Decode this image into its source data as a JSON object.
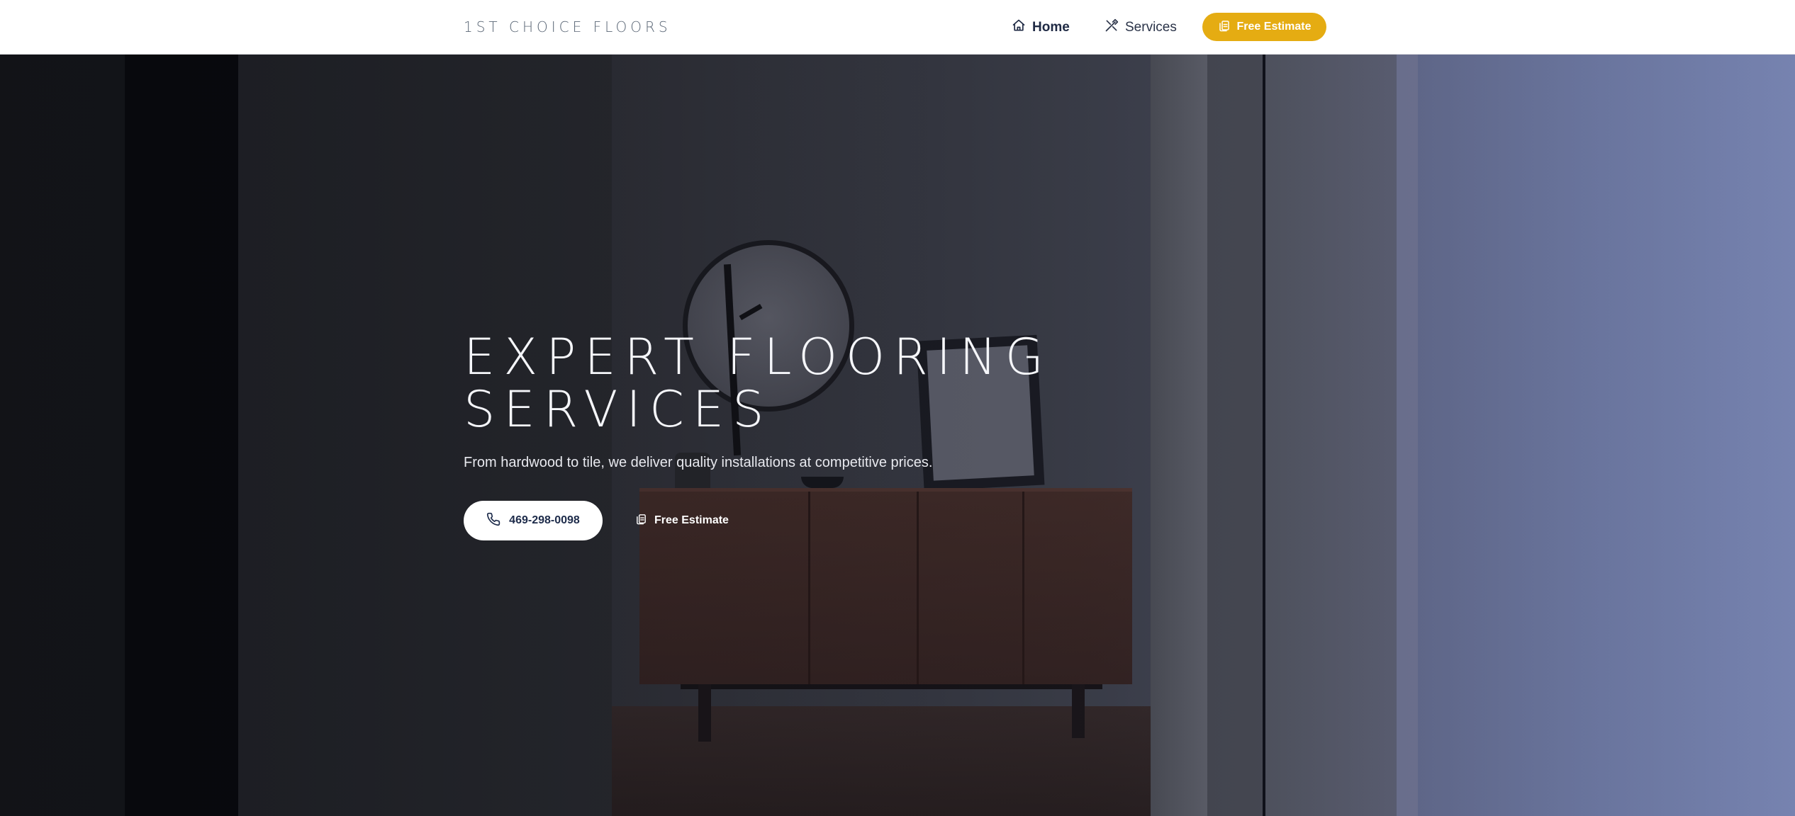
{
  "nav": {
    "brand": "1ST CHOICE FLOORS",
    "links": [
      {
        "label": "Home",
        "icon": "home-icon"
      },
      {
        "label": "Services",
        "icon": "tools-icon"
      }
    ],
    "cta_label": "Free Estimate",
    "cta_icon": "estimate-icon"
  },
  "hero": {
    "title_line1": "EXPERT FLOORING",
    "title_line2": "SERVICES",
    "subtitle": "From hardwood to tile, we deliver quality installations at competitive prices.",
    "phone_label": "469-298-0098",
    "phone_icon": "phone-icon",
    "estimate_label": "Free Estimate",
    "estimate_icon": "estimate-icon"
  },
  "colors": {
    "accent": "#e5ac12",
    "nav_text": "#1f2a44",
    "hero_text": "#f5f6fa"
  }
}
